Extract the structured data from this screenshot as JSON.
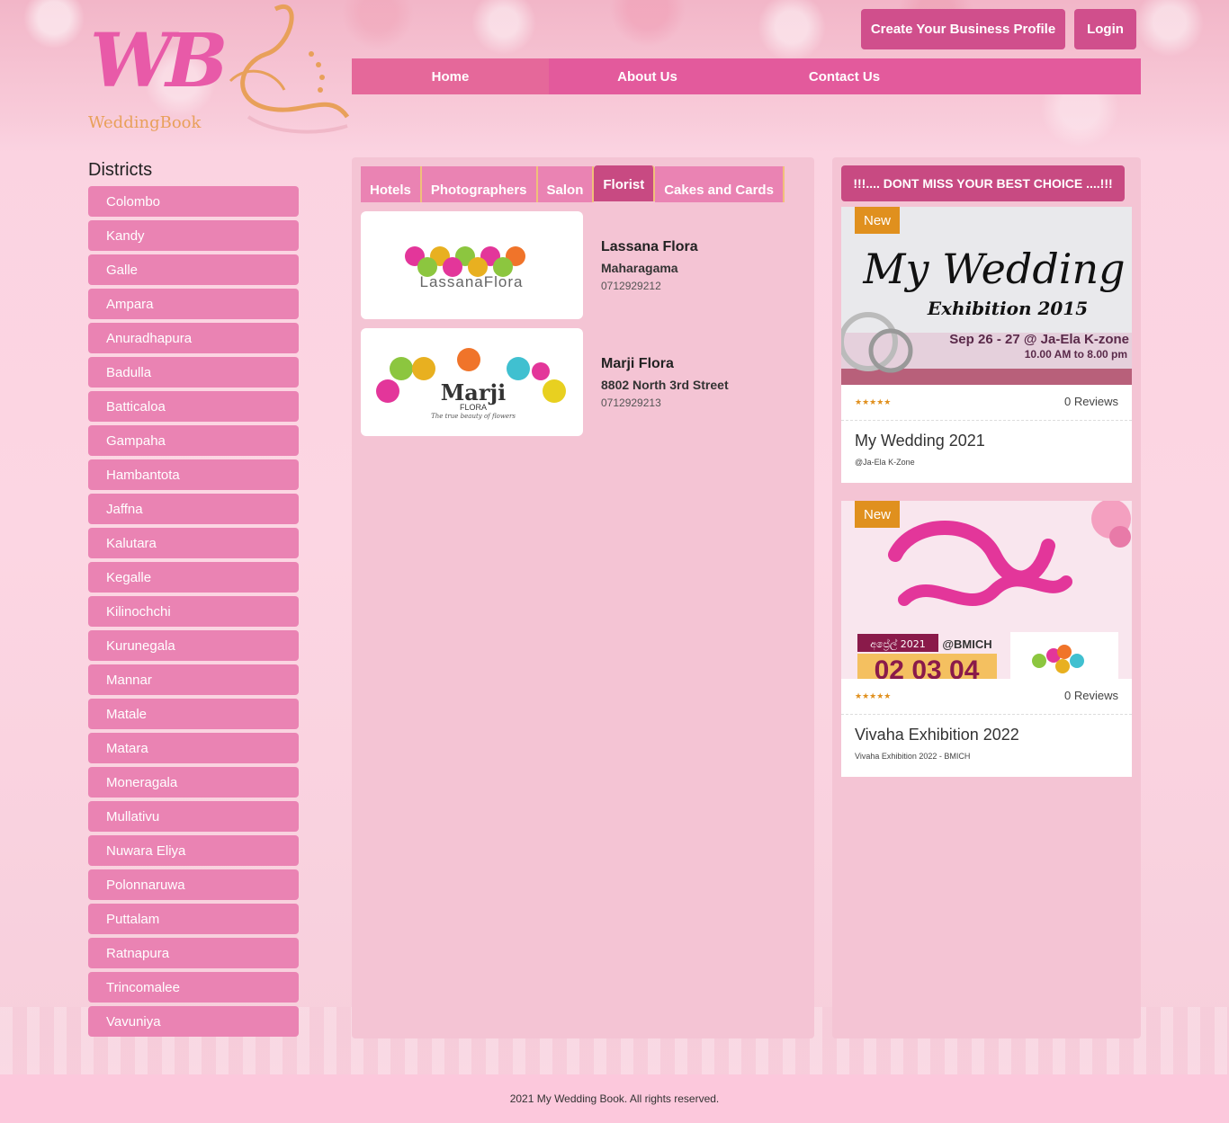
{
  "header": {
    "logo_text": "WB",
    "logo_sub": "WeddingBook",
    "create_profile_label": "Create Your Business Profile",
    "login_label": "Login"
  },
  "nav": {
    "items": [
      {
        "label": "Home"
      },
      {
        "label": "About Us"
      },
      {
        "label": "Contact Us"
      }
    ]
  },
  "sidebar": {
    "title": "Districts",
    "items": [
      "Colombo",
      "Kandy",
      "Galle",
      "Ampara",
      "Anuradhapura",
      "Badulla",
      "Batticaloa",
      "Gampaha",
      "Hambantota",
      "Jaffna",
      "Kalutara",
      "Kegalle",
      "Kilinochchi",
      "Kurunegala",
      "Mannar",
      "Matale",
      "Matara",
      "Moneragala",
      "Mullativu",
      "Nuwara Eliya",
      "Polonnaruwa",
      "Puttalam",
      "Ratnapura",
      "Trincomalee",
      "Vavuniya"
    ]
  },
  "tabs": [
    {
      "label": "Hotels"
    },
    {
      "label": "Photographers"
    },
    {
      "label": "Salon"
    },
    {
      "label": "Florist",
      "active": true
    },
    {
      "label": "Cakes and Cards"
    }
  ],
  "vendors": [
    {
      "name": "Lassana Flora",
      "address": "Maharagama",
      "phone": "0712929212",
      "logo_text": "LassanaFlora"
    },
    {
      "name": "Marji Flora",
      "address": "8802 North 3rd Street",
      "phone": "0712929213",
      "logo_text": "Marji",
      "logo_sub": "FLORA",
      "logo_tagline": "The true beauty of flowers"
    }
  ],
  "promo": {
    "title": "!!!.... DONT MISS YOUR BEST CHOICE ....!!!",
    "cards": [
      {
        "badge": "New",
        "image_text_1": "My Wedding",
        "image_text_2": "Exhibition 2015",
        "image_text_3": "Sep 26 - 27 @ Ja-Ela K-zone",
        "image_text_4": "10.00 AM to 8.00 pm",
        "stars": "★★★★★",
        "reviews": "0 Reviews",
        "title": "My Wedding 2021",
        "subtitle": "@Ja-Ela K-Zone"
      },
      {
        "badge": "New",
        "image_text_1": "@BMICH",
        "image_text_2": "අප්‍රේල් 2021",
        "image_text_3": "02 03 04",
        "stars": "★★★★★",
        "reviews": "0 Reviews",
        "title": "Vivaha Exhibition 2022",
        "subtitle": "Vivaha Exhibition 2022 - BMICH"
      }
    ]
  },
  "footer": {
    "text": "2021 My Wedding Book. All rights reserved."
  },
  "colors": {
    "accent": "#e35a9c",
    "button": "#d04f8c",
    "district": "#ea83b3",
    "badge": "#e0901e"
  }
}
